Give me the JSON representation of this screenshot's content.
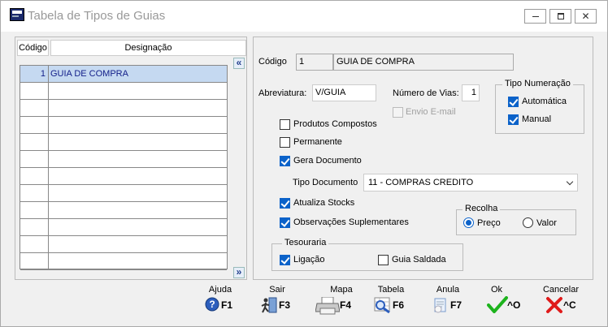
{
  "window": {
    "title": "Tabela de Tipos de Guias",
    "close_glyph": "✕"
  },
  "grid": {
    "col_codigo": "Código",
    "col_designacao": "Designação",
    "rows": [
      {
        "code": "1",
        "name": "GUIA DE COMPRA"
      },
      {
        "code": "",
        "name": ""
      },
      {
        "code": "",
        "name": ""
      },
      {
        "code": "",
        "name": ""
      },
      {
        "code": "",
        "name": ""
      },
      {
        "code": "",
        "name": ""
      },
      {
        "code": "",
        "name": ""
      },
      {
        "code": "",
        "name": ""
      },
      {
        "code": "",
        "name": ""
      },
      {
        "code": "",
        "name": ""
      },
      {
        "code": "",
        "name": ""
      },
      {
        "code": "",
        "name": ""
      }
    ],
    "nav_up_glyph": "«",
    "nav_down_glyph": "»"
  },
  "form": {
    "codigo_label": "Código",
    "codigo_value": "1",
    "codigo_desc": "GUIA DE COMPRA",
    "abreviatura_label": "Abreviatura:",
    "abreviatura_value": "V/GUIA",
    "vias_label": "Número de Vias:",
    "vias_value": "1",
    "envio_email_label": "Envio E-mail",
    "tipo_numeracao_label": "Tipo Numeração",
    "automatica_label": "Automática",
    "manual_label": "Manual",
    "produtos_compostos_label": "Produtos Compostos",
    "permanente_label": "Permanente",
    "gera_documento_label": "Gera Documento",
    "tipo_documento_label": "Tipo Documento",
    "tipo_documento_value": "11 - COMPRAS CREDITO",
    "atualiza_stocks_label": "Atualiza Stocks",
    "observacoes_label": "Observações Suplementares",
    "recolha_label": "Recolha",
    "preco_label": "Preço",
    "valor_label": "Valor",
    "tesouraria_label": "Tesouraria",
    "ligacao_label": "Ligação",
    "guia_saldada_label": "Guia Saldada"
  },
  "toolbar": {
    "ajuda_label": "Ajuda",
    "ajuda_key": "F1",
    "sair_label": "Sair",
    "sair_key": "F3",
    "mapa_label": "Mapa",
    "mapa_key": "F4",
    "tabela_label": "Tabela",
    "tabela_key": "F6",
    "anula_label": "Anula",
    "anula_key": "F7",
    "ok_label": "Ok",
    "ok_key": "^O",
    "cancelar_label": "Cancelar",
    "cancelar_key": "^C"
  },
  "colors": {
    "accent": "#0b62c9",
    "selection": "#c5d9f1",
    "ok_green": "#1db31d",
    "cancel_red": "#e01b1b"
  }
}
